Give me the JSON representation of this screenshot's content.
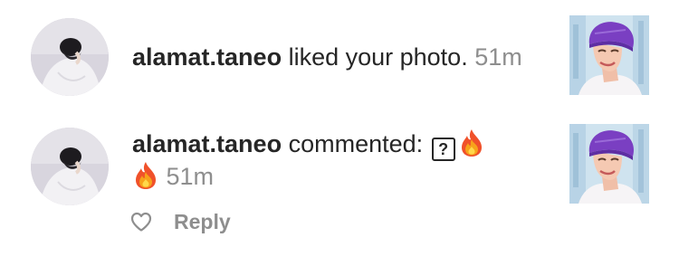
{
  "colors": {
    "text": "#262626",
    "secondary": "#8e8e8e",
    "background": "#ffffff",
    "beanie": "#7a3fc2"
  },
  "notifications": [
    {
      "type": "like",
      "username": "alamat.taneo",
      "action": "liked your photo.",
      "time": "51m",
      "avatar_icon": "profile-photo",
      "thumbnail_icon": "post-thumbnail-illustration"
    },
    {
      "type": "comment",
      "username": "alamat.taneo",
      "action": "commented:",
      "comment_glyph": "?",
      "emojis": [
        "fire-emoji",
        "fire-emoji"
      ],
      "time": "51m",
      "avatar_icon": "profile-photo",
      "thumbnail_icon": "post-thumbnail-illustration",
      "actions": {
        "like_icon": "heart-outline-icon",
        "reply_label": "Reply"
      }
    }
  ]
}
